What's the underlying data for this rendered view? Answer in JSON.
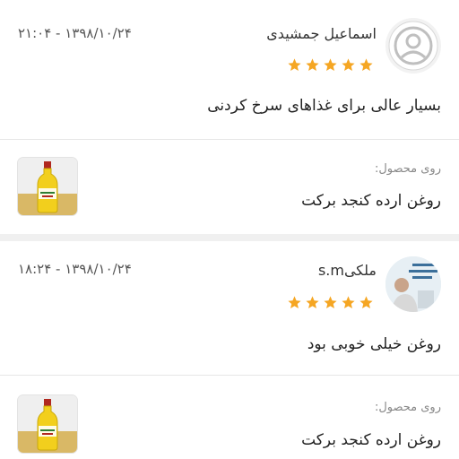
{
  "reviews": [
    {
      "author": "اسماعیل جمشیدی",
      "datetime": "۱۳۹۸/۱۰/۲۴ - ۲۱:۰۴",
      "rating": 5,
      "comment": "بسیار عالی برای غذاهای سرخ کردنی",
      "avatar": "default-user-icon",
      "product_prefix": "روی محصول:",
      "product_name": "روغن ارده کنجد برکت"
    },
    {
      "author": "ملکیs.m",
      "datetime": "۱۳۹۸/۱۰/۲۴ - ۱۸:۲۴",
      "rating": 5,
      "comment": "روغن خیلی خوبی بود",
      "avatar": "user-photo",
      "product_prefix": "روی محصول:",
      "product_name": "روغن ارده کنجد برکت"
    }
  ],
  "colors": {
    "star": "#f5a623",
    "divider": "#e6e6e6"
  }
}
